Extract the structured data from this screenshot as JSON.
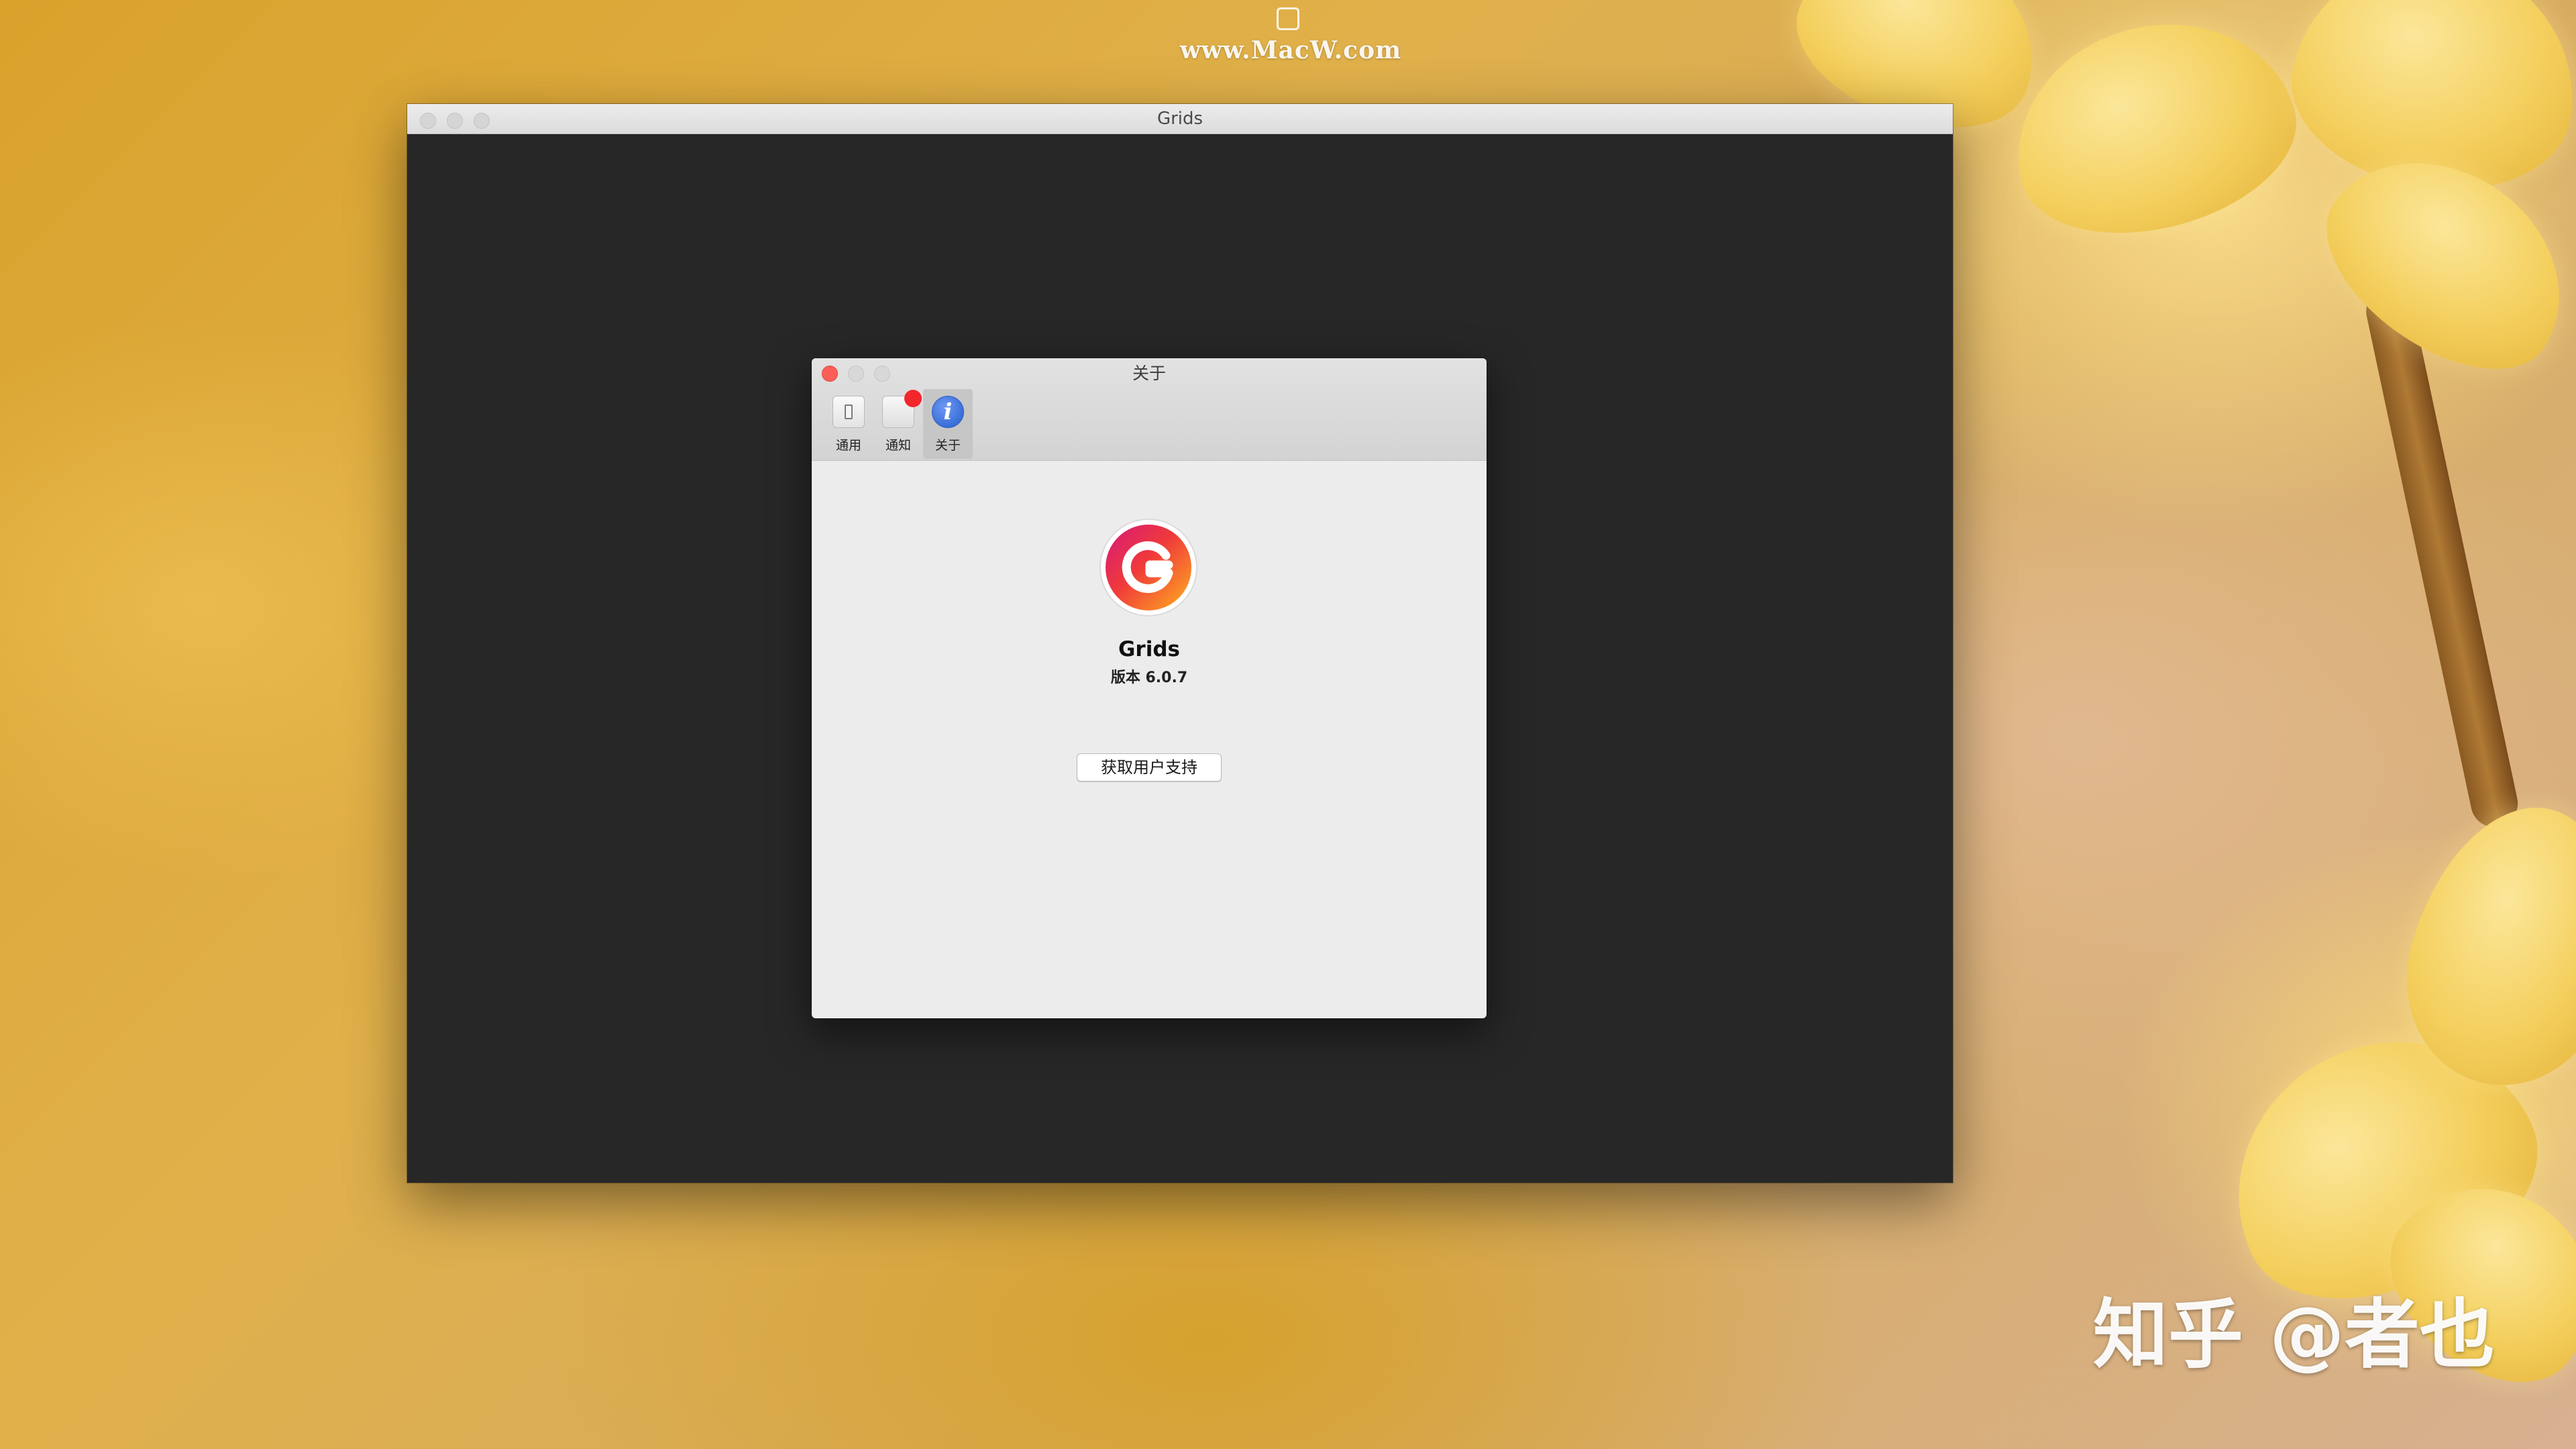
{
  "watermarks": {
    "top": "www.MacW.com",
    "bottom": "知乎 @者也"
  },
  "main_window": {
    "title": "Grids"
  },
  "about_window": {
    "title": "关于",
    "toolbar": [
      {
        "label": "通用",
        "icon": "switch-icon"
      },
      {
        "label": "通知",
        "icon": "notification-icon"
      },
      {
        "label": "关于",
        "icon": "info-icon"
      }
    ],
    "selected_tab": "关于",
    "app_name": "Grids",
    "version": "版本 6.0.7",
    "support_button": "获取用户支持"
  },
  "colors": {
    "close": "#fc5f57",
    "about_icon": "#3a6fd8",
    "notification_badge": "#f3262b"
  }
}
